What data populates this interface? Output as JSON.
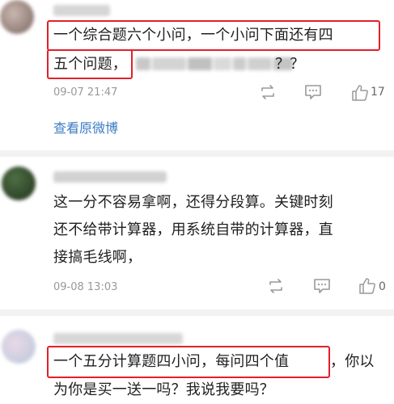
{
  "comments": [
    {
      "text_line1": "一个综合题六个小问，一个小问下面还有四",
      "text_line2_start": "五个问题，",
      "text_line2_end": "？？",
      "timestamp": "09-07 21:47",
      "like_count": "17",
      "view_original": "查看原微博"
    },
    {
      "text_line1": "这一分不容易拿啊，还得分段算。关键时刻",
      "text_line2": "还不给带计算器，用系统自带的计算器，直",
      "text_line3": "接搞毛线啊，",
      "timestamp": "09-08 13:03",
      "like_count": "0"
    },
    {
      "text_line1": "一个五分计算题四小问，每问四个值",
      "text_line1_end": "，你以",
      "text_line2": "为你是买一送一吗？我说我要吗？"
    }
  ],
  "colors": {
    "highlight": "#e2202a",
    "link": "#3b7cc4"
  },
  "icons": [
    "repost-icon",
    "comment-icon",
    "like-icon"
  ]
}
